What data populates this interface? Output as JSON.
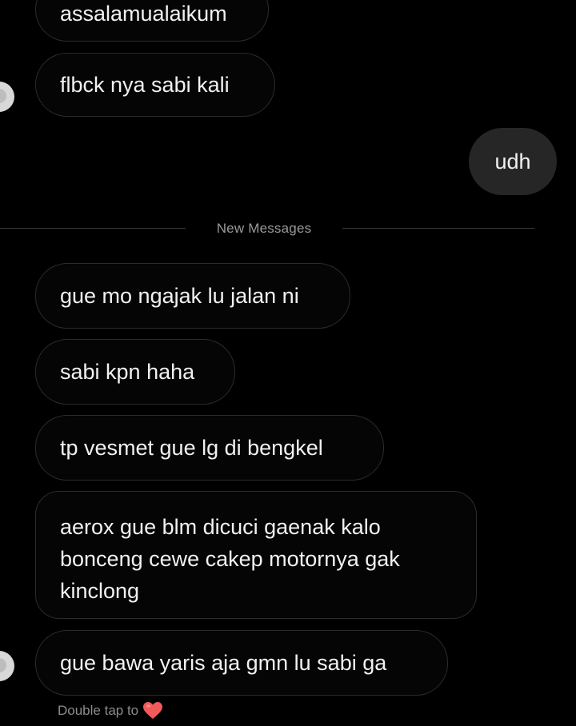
{
  "messages": [
    {
      "text": "assalamualaikum",
      "direction": "incoming"
    },
    {
      "text": "flbck nya sabi kali",
      "direction": "incoming"
    },
    {
      "text": "udh",
      "direction": "outgoing"
    },
    {
      "text": "gue mo ngajak lu jalan ni",
      "direction": "incoming"
    },
    {
      "text": "sabi kpn haha",
      "direction": "incoming"
    },
    {
      "text": "tp vesmet gue lg di bengkel",
      "direction": "incoming"
    },
    {
      "text": "aerox gue blm dicuci gaenak kalo bonceng cewe cakep motornya gak kinclong",
      "direction": "incoming"
    },
    {
      "text": "gue bawa yaris aja gmn lu sabi ga",
      "direction": "incoming"
    }
  ],
  "divider": {
    "label": "New Messages"
  },
  "hint": {
    "text": "Double tap to",
    "icon": "heart-emoji-icon",
    "heart_color": "#f25a5a"
  },
  "colors": {
    "background": "#000000",
    "incoming_border": "#2b2b2b",
    "outgoing_bubble": "#262626",
    "text": "#f1f1f1",
    "muted": "#9a9a9a"
  }
}
